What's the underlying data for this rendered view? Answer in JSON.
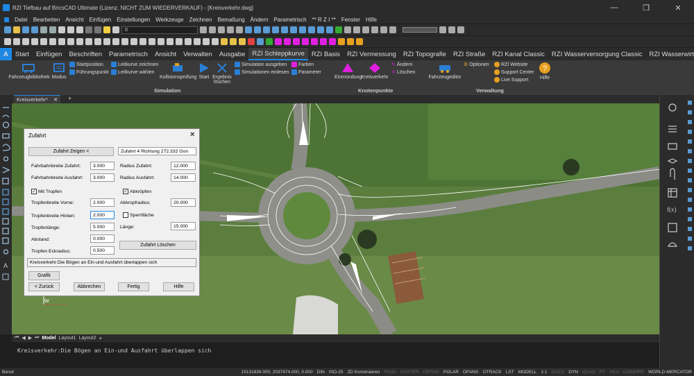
{
  "titlebar": {
    "title": "RZI Tiefbau auf BricsCAD Ultimate (Lizenz. NICHT ZUM WIEDERVERKAUF) - [Kreisverkehr.dwg]",
    "min": "—",
    "max": "❐",
    "close": "✕"
  },
  "menu": [
    "Datei",
    "Bearbeiten",
    "Ansicht",
    "Einfügen",
    "Einstellungen",
    "Werkzeuge",
    "Zeichnen",
    "Bemaßung",
    "Ändern",
    "Parametrisch",
    "** R Z I **",
    "Fenster",
    "Hilfe"
  ],
  "toolbar": {
    "layer_value": "0"
  },
  "ribbon_tabs": [
    "Start",
    "Einfügen",
    "Beschriften",
    "Parametrisch",
    "Ansicht",
    "Verwalten",
    "Ausgabe",
    "RZI Schleppkurve",
    "RZI Basis",
    "RZI Vermessung",
    "RZI Topografie",
    "RZI Straße",
    "RZI Kanal Classic",
    "RZI Wasserversorgung Classic",
    "RZI Wasserwirtschaft Pro"
  ],
  "ribbon": {
    "fahrzeugbibliothek": "Fahrzeugbibliothek",
    "modus": "Modus",
    "startposition": "Startposition",
    "fuehrungspunkt": "Führungspunkt",
    "leitkurve_zeichnen": "Leitkurve zeichnen",
    "leitkurve_waehlen": "Leitkurve wählen",
    "kollisionspruefung": "Kollisionsprüfung",
    "start": "Start",
    "ergebnis_loeschen_1": "Ergebnis",
    "ergebnis_loeschen_2": "löschen",
    "simulation_ausgeben": "Simulation ausgeben",
    "simulationen_einlesen": "Simulationen einlesen",
    "farben": "Farben",
    "parameter": "Parameter",
    "einmuendung": "Einmündung",
    "kreisverkehr": "Kreisverkehr",
    "aendern": "Ändern",
    "loeschen": "Löschen",
    "fahrzeugeditor": "Fahrzeugeditor",
    "optionen": "Optionen",
    "rzi_website": "RZI Website",
    "support_center": "Support Center",
    "live_support": "Live Support",
    "hilfe": "Hilfe",
    "group_simulation": "Simulation",
    "group_knotenpunkte": "Knotenpunkte",
    "group_verwaltung": "Verwaltung"
  },
  "doc_tab": {
    "name": "Kreisverkehr*",
    "close": "✕",
    "add": "+"
  },
  "dialog": {
    "title": "Zufahrt",
    "close": "✕",
    "zeigen_button": "Zufahrt Zeigen <",
    "info": "Zufahrt 4 Richtung 272.332 Gon",
    "fb_zufahrt_label": "Fahrbahnbreite Zufahrt:",
    "fb_zufahrt": "3.000",
    "fb_ausfahrt_label": "Fahrbahnbreite Ausfahrt:",
    "fb_ausfahrt": "3.000",
    "radius_zufahrt_label": "Radius Zufahrt:",
    "radius_zufahrt": "12.000",
    "radius_ausfahrt_label": "Radius Ausfahrt:",
    "radius_ausfahrt": "14.000",
    "mit_tropfen": "Mit Tropfen",
    "abkroepfen": "Abkröpfen",
    "tb_vorne_label": "Tropfenbreite Vorne:",
    "tb_vorne": "2.000",
    "tb_hinten_label": "Tropfenbreite Hinten:",
    "tb_hinten": "2.000",
    "tlaenge_label": "Tropfenlänge:",
    "tlaenge": "5.000",
    "abstand_label": "Abstand:",
    "abstand": "0.000",
    "teckradius_label": "Tropfen Eckradius:",
    "teckradius": "0.500",
    "abkroepfradius_label": "Abkropfradius:",
    "abkroepfradius": "20.000",
    "sperrflaeche": "Sperrfläche",
    "laenge_label": "Länge:",
    "laenge": "15.000",
    "loeschen_button": "Zufahrt Löschen",
    "message": "Kreisverkehr:Die Bögen an Ein-und Ausfahrt überlappen sich",
    "grafik": "Grafik",
    "zurueck": "< Zurück",
    "abbrechen": "Abbrechen",
    "fertig": "Fertig",
    "hilfe": "Hilfe"
  },
  "layout_tabs": [
    "Model",
    "Layout1",
    "Layout2"
  ],
  "command_line": "Kreisverkehr:Die Bögen an Ein-und Ausfahrt überlappen sich",
  "status": {
    "bereit": "Bereit",
    "coords": "15131839.000, 2037474.000, 0.000",
    "din": "DIN",
    "iso": "ISO-25",
    "konstr": "2D Konstruieren",
    "toggles": [
      "FANG",
      "RASTER",
      "ORTHO",
      "POLAR",
      "OFANG",
      "OTRACK",
      "LST",
      "MODELL",
      "1:1",
      "DOCS",
      "DYN",
      "QUAD",
      "RT",
      "HKA",
      "GIZMORE"
    ],
    "crs": "WORLD-MERCATOR"
  },
  "colors": {
    "accent": "#1e88e5",
    "magenta": "#e020e0",
    "ribbon_blue": "#2a7fd4"
  }
}
